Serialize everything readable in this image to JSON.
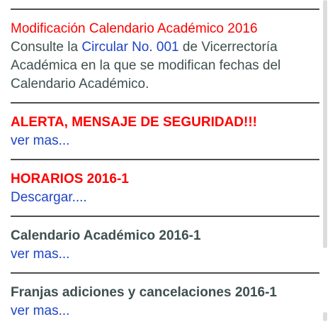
{
  "items": [
    {
      "heading": "Modificación Calendario Académico 2016",
      "body_prefix": "Consulte la ",
      "link_text": "Circular No. 001",
      "body_suffix": " de Vicerrectoría Académica en la que se modifican fechas del Calendario Académico."
    },
    {
      "title": "ALERTA, MENSAJE DE SEGURIDAD!!!",
      "link_text": "ver mas..."
    },
    {
      "title": "HORARIOS 2016-1",
      "link_text": "Descargar...."
    },
    {
      "title": "Calendario Académico 2016-1",
      "link_text": "ver mas..."
    },
    {
      "title": "Franjas adiciones y cancelaciones 2016-1",
      "link_text": "ver mas..."
    }
  ],
  "colors": {
    "alert": "#ff0000",
    "link": "#1f44c6",
    "text": "#3f4f4f",
    "rule": "#4d4d4d"
  }
}
